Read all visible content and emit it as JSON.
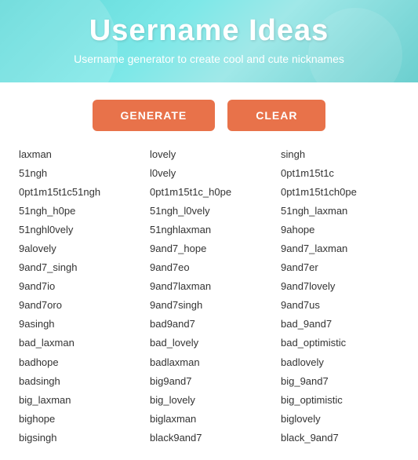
{
  "header": {
    "title": "Username Ideas",
    "subtitle": "Username generator to create cool and cute nicknames"
  },
  "buttons": {
    "generate_label": "GENERATE",
    "clear_label": "CLEAR"
  },
  "columns": [
    {
      "items": [
        "laxman",
        "51ngh",
        "0pt1m15t1c51ngh",
        "51ngh_h0pe",
        "51nghl0vely",
        "9alovely",
        "9and7_singh",
        "9and7io",
        "9and7oro",
        "9asingh",
        "bad_laxman",
        "badhope",
        "badsingh",
        "big_laxman",
        "bighope",
        "bigsingh"
      ]
    },
    {
      "items": [
        "lovely",
        "l0vely",
        "0pt1m15t1c_h0pe",
        "51ngh_l0vely",
        "51nghlaxman",
        "9and7_hope",
        "9and7eo",
        "9and7laxman",
        "9and7singh",
        "bad9and7",
        "bad_lovely",
        "badlaxman",
        "big9and7",
        "big_lovely",
        "biglaxman",
        "black9and7"
      ]
    },
    {
      "items": [
        "singh",
        "0pt1m15t1c",
        "0pt1m15t1ch0pe",
        "51ngh_laxman",
        "9ahope",
        "9and7_laxman",
        "9and7er",
        "9and7lovely",
        "9and7us",
        "bad_9and7",
        "bad_optimistic",
        "badlovely",
        "big_9and7",
        "big_optimistic",
        "biglovely",
        "black_9and7"
      ]
    }
  ]
}
